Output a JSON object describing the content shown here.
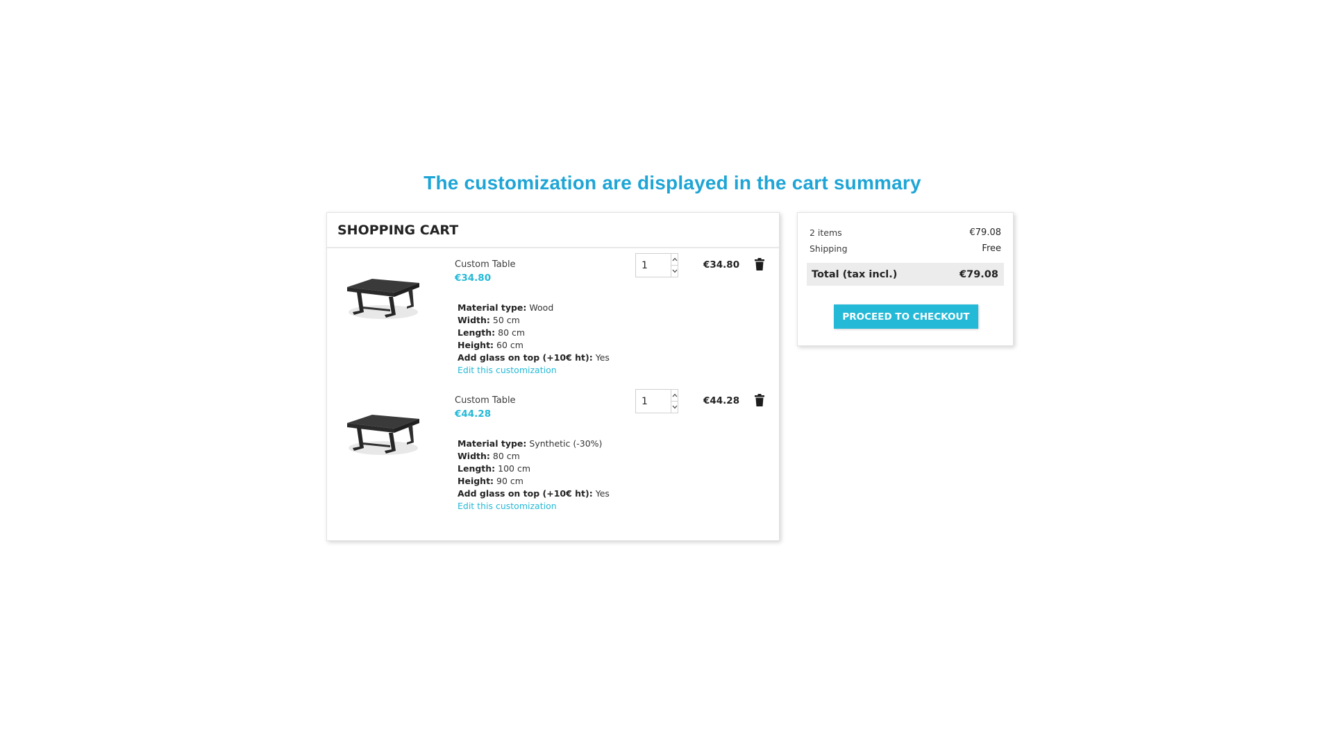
{
  "headline": "The customization are displayed in the cart summary",
  "colors": {
    "accent": "#24b9d7",
    "headline": "#1ea5d6",
    "total_bar": "#ececec"
  },
  "cart": {
    "title": "SHOPPING CART",
    "items": [
      {
        "name": "Custom Table",
        "unit_price": "€34.80",
        "quantity": "1",
        "line_total": "€34.80",
        "customizations": [
          {
            "label": "Material type:",
            "value": "Wood"
          },
          {
            "label": "Width:",
            "value": "50 cm"
          },
          {
            "label": "Length:",
            "value": "80 cm"
          },
          {
            "label": "Height:",
            "value": "60 cm"
          },
          {
            "label": "Add glass on top (+10€ ht):",
            "value": "Yes"
          }
        ],
        "edit_link": "Edit this customization",
        "image_icon": "table-image",
        "delete_icon": "trash-icon"
      },
      {
        "name": "Custom Table",
        "unit_price": "€44.28",
        "quantity": "1",
        "line_total": "€44.28",
        "customizations": [
          {
            "label": "Material type:",
            "value": "Synthetic (-30%)"
          },
          {
            "label": "Width:",
            "value": "80 cm"
          },
          {
            "label": "Length:",
            "value": "100 cm"
          },
          {
            "label": "Height:",
            "value": "90 cm"
          },
          {
            "label": "Add glass on top (+10€ ht):",
            "value": "Yes"
          }
        ],
        "edit_link": "Edit this customization",
        "image_icon": "table-image",
        "delete_icon": "trash-icon"
      }
    ]
  },
  "summary": {
    "items_label": "2 items",
    "items_value": "€79.08",
    "shipping_label": "Shipping",
    "shipping_value": "Free",
    "total_label": "Total (tax incl.)",
    "total_value": "€79.08",
    "checkout_label": "PROCEED TO CHECKOUT"
  }
}
